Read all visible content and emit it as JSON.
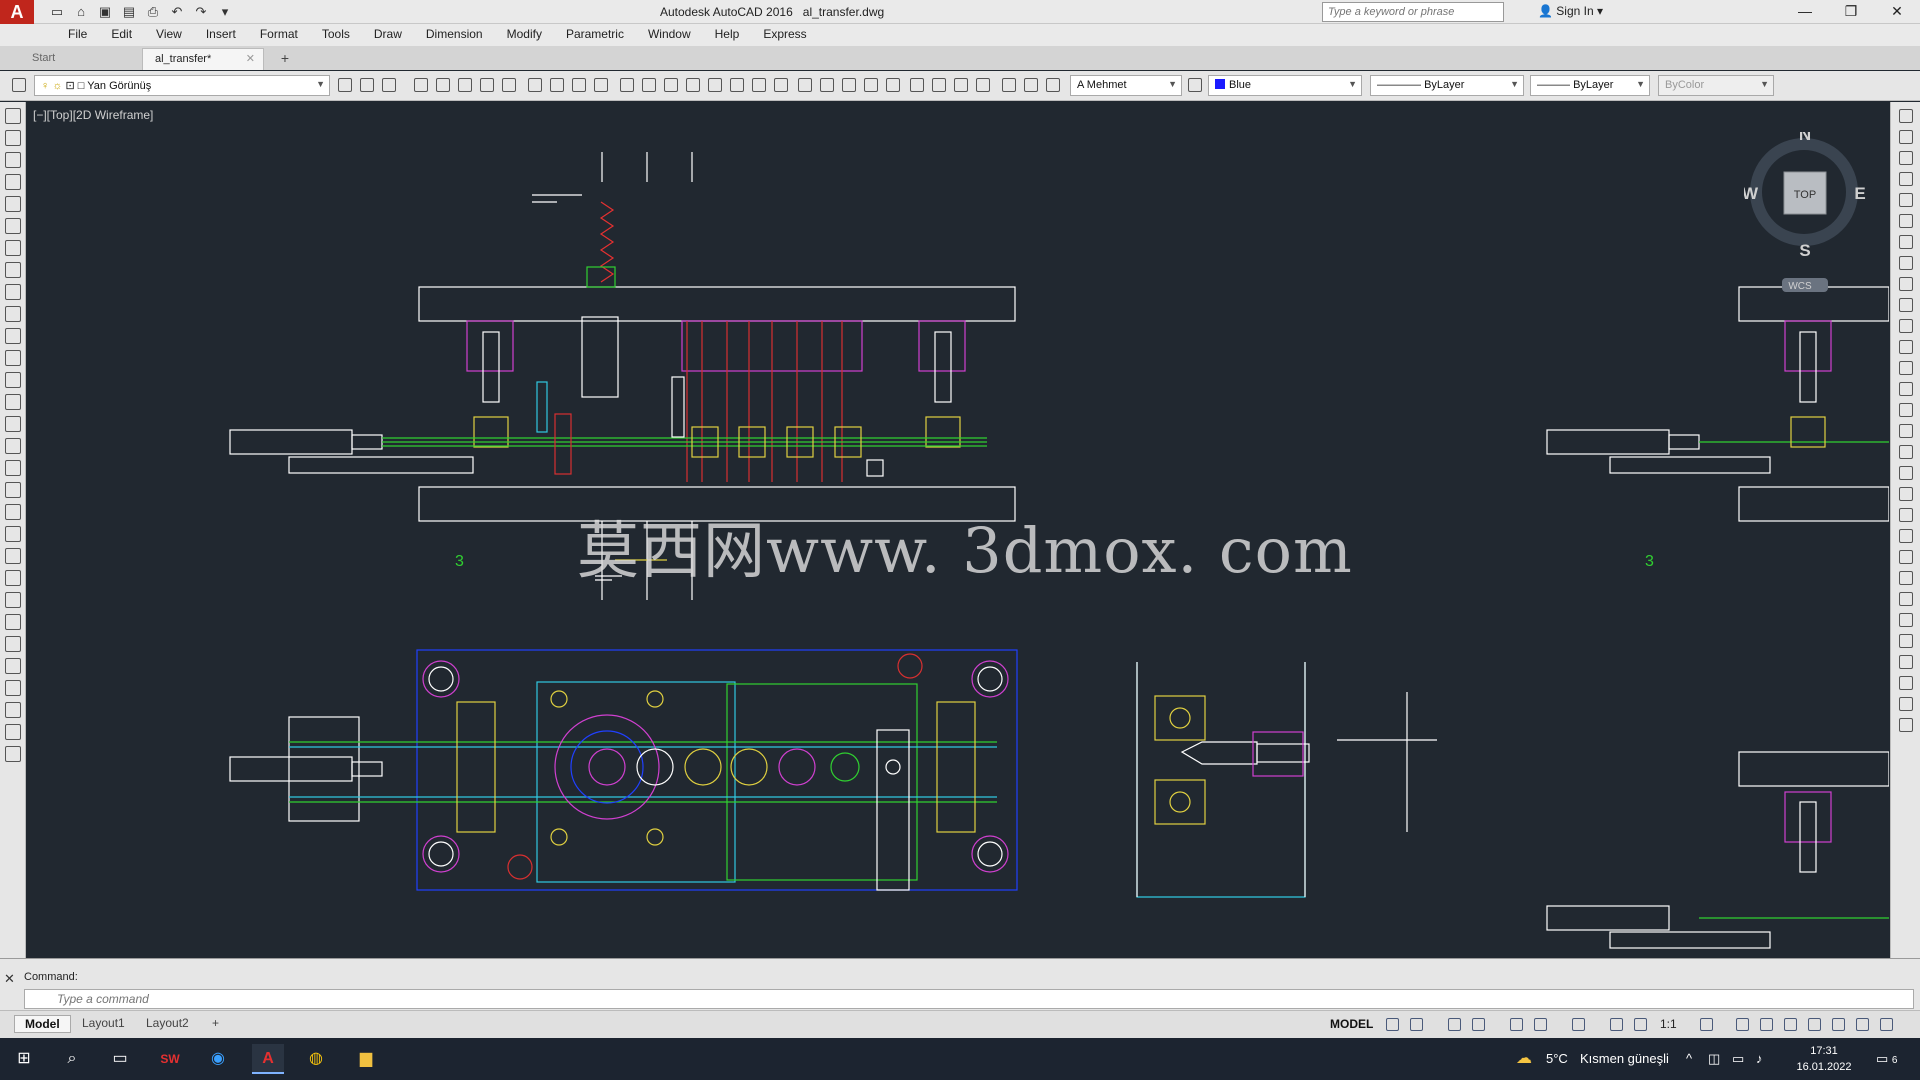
{
  "window": {
    "app_name": "Autodesk AutoCAD 2016",
    "file_name": "al_transfer.dwg",
    "search_placeholder": "Type a keyword or phrase",
    "sign_in": "Sign In"
  },
  "menu": [
    "File",
    "Edit",
    "View",
    "Insert",
    "Format",
    "Tools",
    "Draw",
    "Dimension",
    "Modify",
    "Parametric",
    "Window",
    "Help",
    "Express"
  ],
  "tabs": {
    "start": "Start",
    "active": "al_transfer*"
  },
  "properties": {
    "layer": "Yan Görünüş",
    "text_style": "Mehmet",
    "color": "Blue",
    "linetype": "ByLayer",
    "lineweight": "ByLayer",
    "plotstyle": "ByColor"
  },
  "viewport": {
    "label": "[−][Top][2D Wireframe]",
    "watermark": "莫西网www. 3dmox. com",
    "note_left": "3",
    "note_right": "3"
  },
  "viewcube": {
    "n": "N",
    "s": "S",
    "e": "E",
    "w": "W",
    "face": "TOP",
    "wcs": "WCS"
  },
  "command": {
    "history": "Command:",
    "placeholder": "Type a command"
  },
  "layouts": [
    "Model",
    "Layout1",
    "Layout2"
  ],
  "status": {
    "space": "MODEL",
    "scale": "1:1"
  },
  "taskbar": {
    "weather_temp": "5°C",
    "weather_desc": "Kısmen güneşli",
    "time": "17:31",
    "date": "16.01.2022",
    "notifications": "6"
  }
}
